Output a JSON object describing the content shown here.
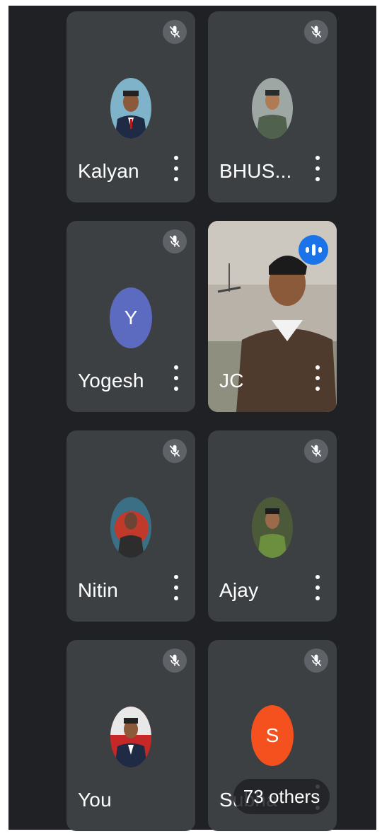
{
  "participants": [
    {
      "name": "Kalyan",
      "muted": true,
      "avatar_type": "photo",
      "avatar_icon": "profile-photo"
    },
    {
      "name": "BHUS...",
      "muted": true,
      "avatar_type": "photo",
      "avatar_icon": "profile-photo"
    },
    {
      "name": "Yogesh",
      "muted": true,
      "avatar_type": "letter",
      "initial": "Y",
      "avatar_color": "#5c6bc0"
    },
    {
      "name": "JC",
      "muted": false,
      "speaking": true,
      "avatar_type": "video"
    },
    {
      "name": "Nitin",
      "muted": true,
      "avatar_type": "photo",
      "avatar_icon": "profile-photo"
    },
    {
      "name": "Ajay",
      "muted": true,
      "avatar_type": "photo",
      "avatar_icon": "profile-photo"
    },
    {
      "name": "You",
      "muted": true,
      "avatar_type": "photo",
      "avatar_icon": "profile-photo"
    },
    {
      "name": "Subha",
      "muted": true,
      "avatar_type": "letter",
      "initial": "S",
      "avatar_color": "#f4511e"
    }
  ],
  "others_badge": "73 others",
  "colors": {
    "background": "#202124",
    "tile": "#3c4043",
    "mute_badge": "#5f6368",
    "speaking": "#1a73e8"
  },
  "icons": {
    "mute": "mic-off-icon",
    "menu": "more-vert-icon",
    "speaking": "audio-level-icon"
  }
}
